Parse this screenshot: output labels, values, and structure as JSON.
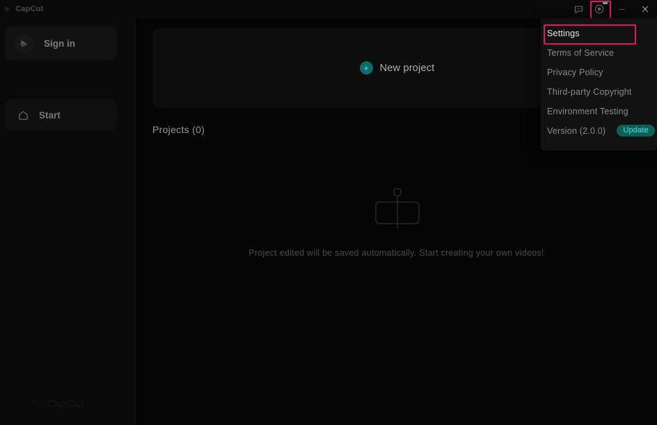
{
  "app": {
    "name": "CapCut",
    "accent_teal": "#2fbfa8",
    "highlight_red": "#e8165e",
    "background": "#050505",
    "panel_background": "#0d0d0d"
  },
  "titlebar": {
    "brand": "CapCut",
    "logo_icon": "capcut-logo-icon",
    "buttons": [
      {
        "name": "feedback-icon",
        "label": "Feedback"
      },
      {
        "name": "help-icon",
        "label": "Help",
        "highlighted": true,
        "badge": true
      },
      {
        "name": "minimize-icon",
        "label": "Minimize"
      },
      {
        "name": "close-icon",
        "label": "Close"
      }
    ]
  },
  "sidebar": {
    "signin": {
      "label": "Sign in",
      "icon": "user-avatar-icon"
    },
    "start": {
      "label": "Start",
      "icon": "home-icon"
    },
    "watermark": {
      "text": "CapCut",
      "icon": "capcut-logo-icon"
    }
  },
  "main": {
    "new_project": {
      "label": "New project",
      "icon": "plus-circle-icon"
    },
    "projects_header": "Projects (0)",
    "empty_state": {
      "icon": "timeline-clip-icon",
      "message": "Project edited will be saved automatically. Start creating your own videos!"
    }
  },
  "dropdown": {
    "items": [
      {
        "label": "Settings",
        "selected": true
      },
      {
        "label": "Terms of Service",
        "selected": false
      },
      {
        "label": "Privacy Policy",
        "selected": false
      },
      {
        "label": "Third-party Copyright",
        "selected": false
      },
      {
        "label": "Environment Testing",
        "selected": false
      },
      {
        "label": "Version (2.0.0)",
        "selected": false,
        "badge": "Update"
      }
    ]
  }
}
